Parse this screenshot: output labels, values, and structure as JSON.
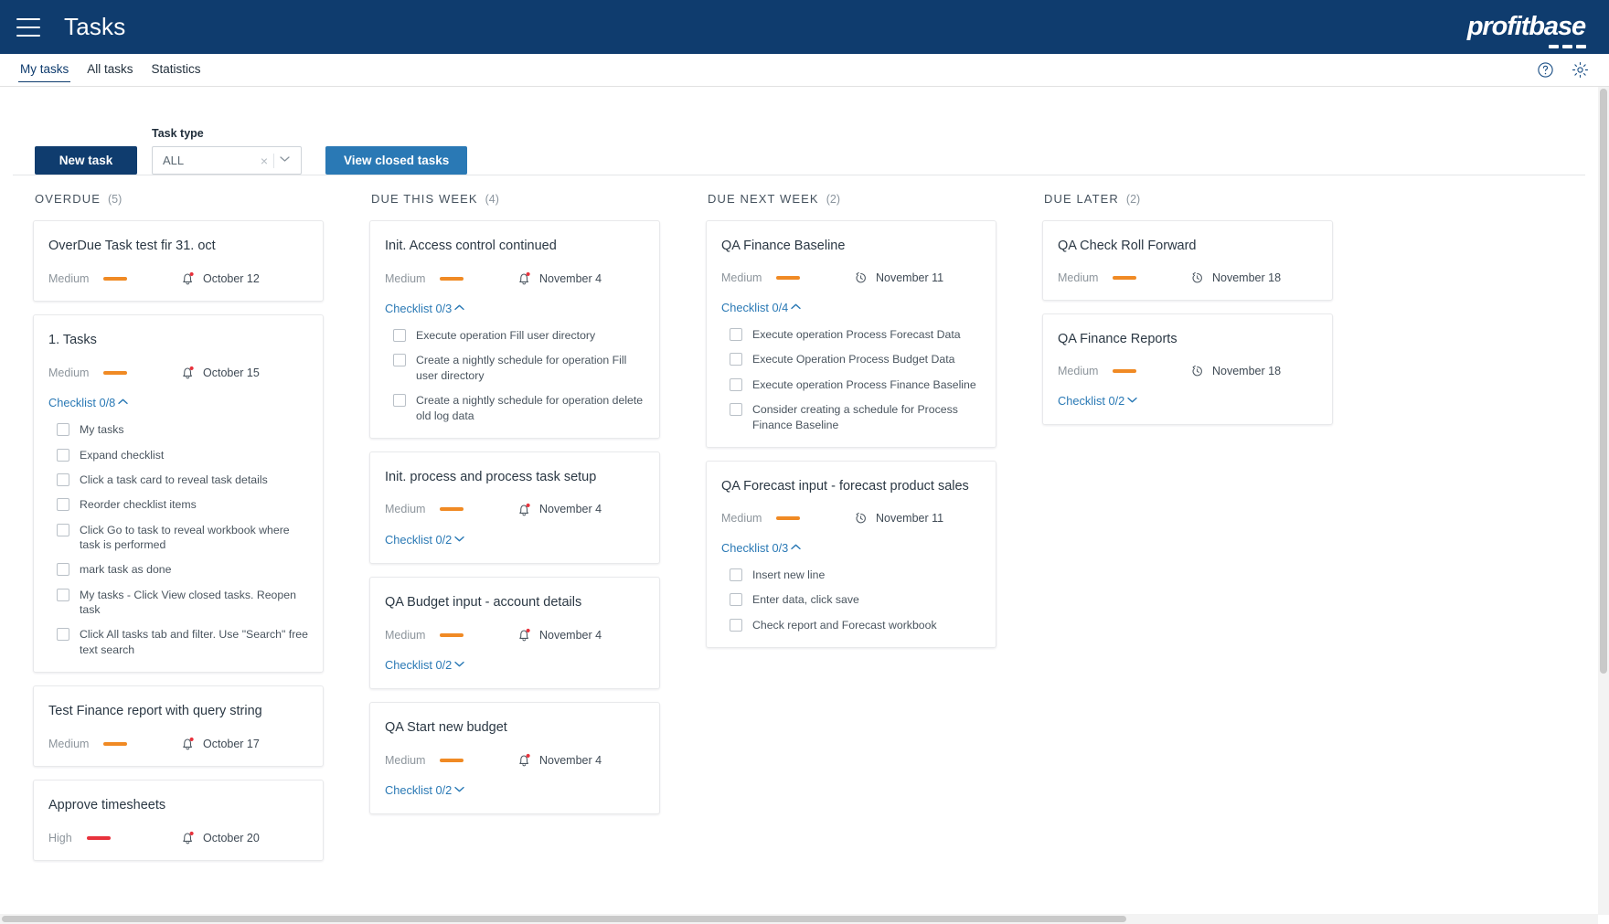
{
  "appbar": {
    "menu_icon": "hamburger-icon",
    "title": "Tasks",
    "logo_text": "profitbase"
  },
  "tabs": [
    {
      "label": "My tasks",
      "active": true
    },
    {
      "label": "All tasks",
      "active": false
    },
    {
      "label": "Statistics",
      "active": false
    }
  ],
  "header_icons": [
    {
      "name": "help-icon",
      "glyph": "?"
    },
    {
      "name": "gear-icon",
      "glyph": "⚙"
    }
  ],
  "toolbar": {
    "new_task_label": "New task",
    "task_type_label": "Task type",
    "task_type_value": "ALL",
    "task_type_placeholder": "ALL",
    "clear_glyph": "×",
    "caret_glyph": "⌄",
    "view_closed_label": "View closed tasks"
  },
  "colors": {
    "brand_dark": "#0f3c6e",
    "brand_blue": "#2a79b5",
    "priority_medium": "#f08a24",
    "priority_high": "#e8323c",
    "alert_dot": "#e8323c"
  },
  "columns": [
    {
      "title": "OVERDUE",
      "count": "(5)",
      "cards": [
        {
          "title": "OverDue Task test fir 31. oct",
          "priority": "Medium",
          "priority_level": "medium",
          "due_icon": "bell-alert-icon",
          "due_date": "October 12",
          "checklist": null
        },
        {
          "title": "1. Tasks",
          "priority": "Medium",
          "priority_level": "medium",
          "due_icon": "bell-alert-icon",
          "due_date": "October 15",
          "checklist": {
            "label": "Checklist 0/8",
            "expanded": true,
            "chevron": "∧",
            "items": [
              "My tasks",
              "Expand checklist",
              "Click a task card to reveal task details",
              "Reorder checklist items",
              "Click Go to task to reveal workbook where task is performed",
              "mark task as done",
              "My tasks - Click View closed tasks. Reopen task",
              "Click All tasks tab and filter. Use \"Search\" free text search"
            ]
          }
        },
        {
          "title": "Test Finance report with query string",
          "priority": "Medium",
          "priority_level": "medium",
          "due_icon": "bell-alert-icon",
          "due_date": "October 17",
          "checklist": null
        },
        {
          "title": "Approve timesheets",
          "priority": "High",
          "priority_level": "high",
          "due_icon": "bell-alert-icon",
          "due_date": "October 20",
          "checklist": null
        }
      ]
    },
    {
      "title": "DUE THIS WEEK",
      "count": "(4)",
      "cards": [
        {
          "title": "Init. Access control continued",
          "priority": "Medium",
          "priority_level": "medium",
          "due_icon": "bell-alert-icon",
          "due_date": "November 4",
          "checklist": {
            "label": "Checklist 0/3",
            "expanded": true,
            "chevron": "∧",
            "items": [
              "Execute operation Fill user directory",
              "Create a nightly schedule for operation Fill user directory",
              "Create a nightly schedule for operation delete old log data"
            ]
          }
        },
        {
          "title": "Init. process and process task setup",
          "priority": "Medium",
          "priority_level": "medium",
          "due_icon": "bell-alert-icon",
          "due_date": "November 4",
          "checklist": {
            "label": "Checklist 0/2",
            "expanded": false,
            "chevron": "∨",
            "items": []
          }
        },
        {
          "title": "QA Budget input - account details",
          "priority": "Medium",
          "priority_level": "medium",
          "due_icon": "bell-alert-icon",
          "due_date": "November 4",
          "checklist": {
            "label": "Checklist 0/2",
            "expanded": false,
            "chevron": "∨",
            "items": []
          }
        },
        {
          "title": "QA Start new budget",
          "priority": "Medium",
          "priority_level": "medium",
          "due_icon": "bell-alert-icon",
          "due_date": "November 4",
          "checklist": {
            "label": "Checklist 0/2",
            "expanded": false,
            "chevron": "∨",
            "items": []
          }
        }
      ]
    },
    {
      "title": "DUE NEXT WEEK",
      "count": "(2)",
      "cards": [
        {
          "title": "QA Finance Baseline",
          "priority": "Medium",
          "priority_level": "medium",
          "due_icon": "clock-history-icon",
          "due_date": "November 11",
          "checklist": {
            "label": "Checklist 0/4",
            "expanded": true,
            "chevron": "∧",
            "items": [
              "Execute operation Process Forecast Data",
              "Execute Operation Process Budget Data",
              "Execute operation Process Finance Baseline",
              "Consider creating a schedule for Process Finance Baseline"
            ]
          }
        },
        {
          "title": "QA Forecast input - forecast product sales",
          "priority": "Medium",
          "priority_level": "medium",
          "due_icon": "clock-history-icon",
          "due_date": "November 11",
          "checklist": {
            "label": "Checklist 0/3",
            "expanded": true,
            "chevron": "∧",
            "items": [
              "Insert new line",
              "Enter data, click save",
              "Check report and Forecast workbook"
            ]
          }
        }
      ]
    },
    {
      "title": "DUE LATER",
      "count": "(2)",
      "cards": [
        {
          "title": "QA Check Roll Forward",
          "priority": "Medium",
          "priority_level": "medium",
          "due_icon": "clock-history-icon",
          "due_date": "November 18",
          "checklist": null
        },
        {
          "title": "QA Finance Reports",
          "priority": "Medium",
          "priority_level": "medium",
          "due_icon": "clock-history-icon",
          "due_date": "November 18",
          "checklist": {
            "label": "Checklist 0/2",
            "expanded": false,
            "chevron": "∨",
            "items": []
          }
        }
      ]
    }
  ]
}
